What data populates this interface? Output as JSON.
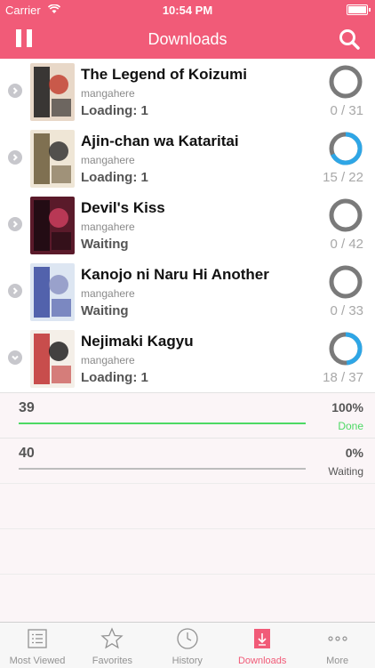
{
  "status_bar": {
    "carrier": "Carrier",
    "time": "10:54 PM"
  },
  "nav": {
    "title": "Downloads",
    "pause_icon": "pause-icon",
    "search_icon": "search-icon"
  },
  "colors": {
    "accent": "#f15b78",
    "progress": "#2ea6e6",
    "ring_track": "#7a7a7a",
    "done": "#4cd964"
  },
  "manga": [
    {
      "title": "The Legend of Koizumi",
      "source": "mangahere",
      "status": "Loading: 1",
      "count": "0 / 31",
      "done": 0,
      "total": 31,
      "expanded": false
    },
    {
      "title": "Ajin-chan wa Kataritai",
      "source": "mangahere",
      "status": "Loading: 1",
      "count": "15 / 22",
      "done": 15,
      "total": 22,
      "expanded": false
    },
    {
      "title": "Devil's Kiss",
      "source": "mangahere",
      "status": "Waiting",
      "count": "0 / 42",
      "done": 0,
      "total": 42,
      "expanded": false
    },
    {
      "title": "Kanojo ni Naru Hi Another",
      "source": "mangahere",
      "status": "Waiting",
      "count": "0 / 33",
      "done": 0,
      "total": 33,
      "expanded": false
    },
    {
      "title": "Nejimaki Kagyu",
      "source": "mangahere",
      "status": "Loading: 1",
      "count": "18 / 37",
      "done": 18,
      "total": 37,
      "expanded": true
    }
  ],
  "chapters": [
    {
      "number": "39",
      "percent_text": "100%",
      "progress": 1.0,
      "status": "Done"
    },
    {
      "number": "40",
      "percent_text": "0%",
      "progress": 0.0,
      "status": "Waiting"
    }
  ],
  "tabs": [
    {
      "label": "Most Viewed",
      "icon": "list-icon",
      "active": false
    },
    {
      "label": "Favorites",
      "icon": "star-icon",
      "active": false
    },
    {
      "label": "History",
      "icon": "clock-icon",
      "active": false
    },
    {
      "label": "Downloads",
      "icon": "download-icon",
      "active": true
    },
    {
      "label": "More",
      "icon": "more-icon",
      "active": false
    }
  ]
}
